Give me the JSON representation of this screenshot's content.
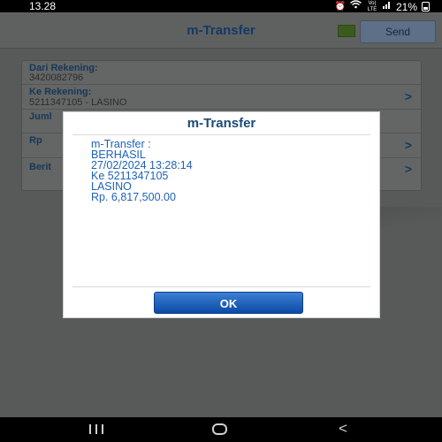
{
  "status_bar": {
    "time": "13.28",
    "network": "Vo) LTE",
    "battery": "21%",
    "icons": [
      "alarm-icon",
      "wifi-icon",
      "signal-icon",
      "battery-icon"
    ]
  },
  "app_bar": {
    "title": "m-Transfer",
    "send_label": "Send"
  },
  "form": {
    "from_label": "Dari Rekening:",
    "from_value": "3420082796",
    "to_label": "Ke Rekening:",
    "to_value": "5211347105 - LASINO",
    "amount_label": "Juml",
    "currency_label": "Rp",
    "note_label": "Berit"
  },
  "dialog": {
    "title": "m-Transfer",
    "message": "m-Transfer :\nBERHASIL\n27/02/2024 13:28:14\nKe 5211347105\nLASINO\nRp. 6,817,500.00",
    "ok_label": "OK"
  },
  "colors": {
    "accent": "#1e62b8",
    "title_blue": "#1d4a7a",
    "button_top": "#3d7fd4",
    "button_bottom": "#0b4ba5"
  }
}
